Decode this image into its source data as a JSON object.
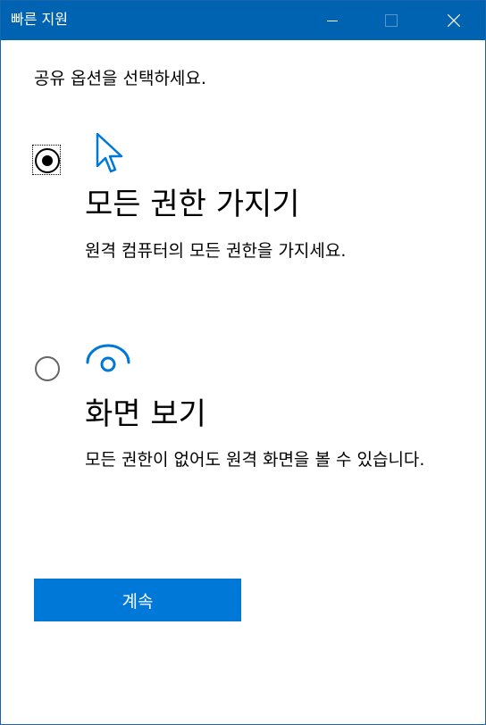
{
  "window": {
    "title": "빠른 지원"
  },
  "prompt": "공유 옵션을 선택하세요.",
  "options": [
    {
      "id": "full-control",
      "title": "모든 권한 가지기",
      "description": "원격 컴퓨터의 모든 권한을 가지세요.",
      "icon": "cursor-arrow-icon",
      "selected": true
    },
    {
      "id": "view-only",
      "title": "화면 보기",
      "description": "모든 권한이 없어도 원격 화면을 볼 수 있습니다.",
      "icon": "eye-icon",
      "selected": false
    }
  ],
  "continue_label": "계속",
  "colors": {
    "titlebar": "#0063b1",
    "accent": "#0078d7"
  }
}
